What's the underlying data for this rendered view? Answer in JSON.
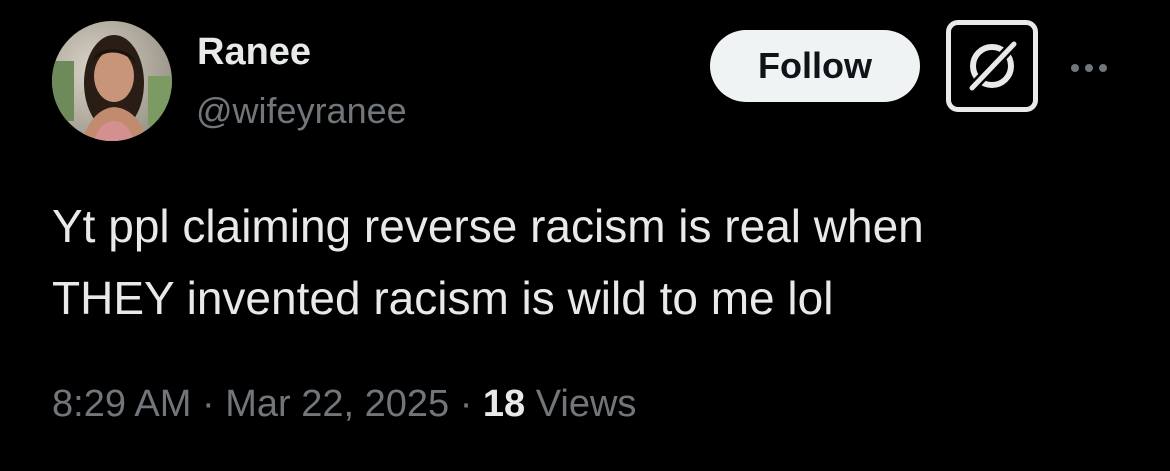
{
  "author": {
    "display_name": "Ranee",
    "handle": "@wifeyranee",
    "avatar_icon": "profile-photo"
  },
  "actions": {
    "follow_label": "Follow",
    "grok_icon": "grok-icon",
    "more_icon": "more-options-icon"
  },
  "tweet": {
    "text_line_1": "Yt ppl claiming reverse racism is real when",
    "text_line_2": "THEY invented racism is wild to me lol"
  },
  "meta": {
    "time": "8:29 AM",
    "separator": "·",
    "date": "Mar 22, 2025",
    "views_count": "18",
    "views_label": "Views"
  },
  "colors": {
    "background": "#000000",
    "primary_text": "#e7e9ea",
    "secondary_text": "#71767b",
    "follow_bg": "#eff3f4",
    "follow_text": "#0f1419"
  }
}
